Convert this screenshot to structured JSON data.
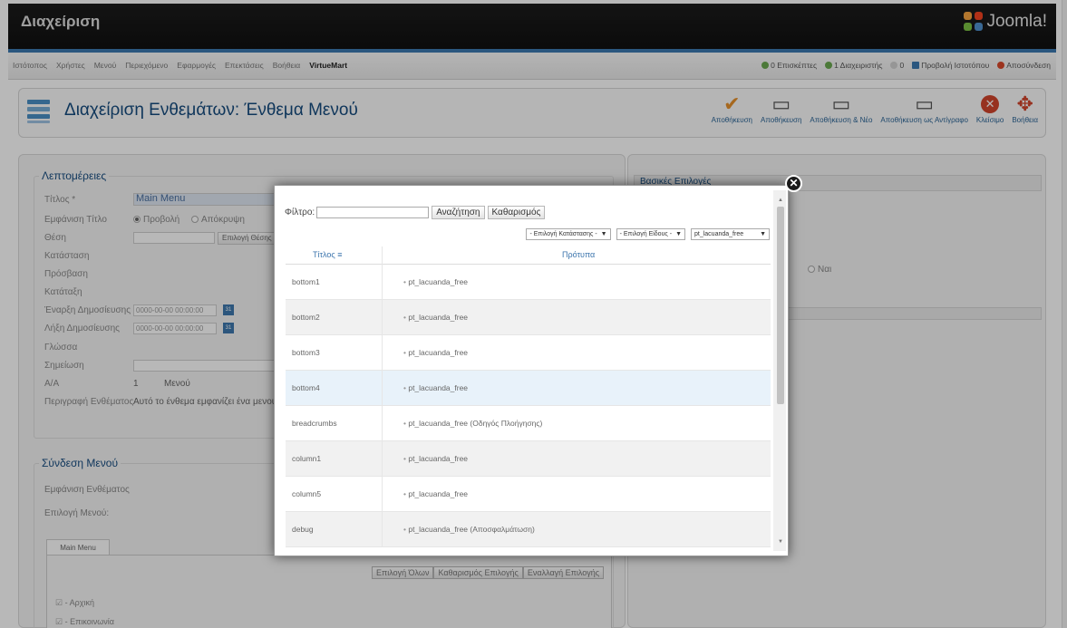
{
  "header": {
    "brand": "Διαχείριση",
    "logo_text": "Joomla!"
  },
  "menu": {
    "items": [
      "Ιστότοπος",
      "Χρήστες",
      "Μενού",
      "Περιεχόμενο",
      "Εφαρμογές",
      "Επεκτάσεις",
      "Βοήθεια",
      "VirtueMart"
    ],
    "status": {
      "visitors": "0 Επισκέπτες",
      "admins": "1 Διαχειριστής",
      "messages": "0",
      "view_site": "Προβολή Ιστοτόπου",
      "logout": "Αποσύνδεση"
    }
  },
  "toolbar": {
    "title": "Διαχείριση Ενθεμάτων: Ένθεμα Μενού",
    "buttons": [
      "Αποθήκευση",
      "Αποθήκευση",
      "Αποθήκευση & Νέο",
      "Αποθήκευση ως Αντίγραφο",
      "Κλείσιμο",
      "Βοήθεια"
    ]
  },
  "details": {
    "legend": "Λεπτομέρειες",
    "labels": {
      "title": "Τίτλος *",
      "show_title": "Εμφάνιση Τίτλο",
      "position": "Θέση",
      "status": "Κατάσταση",
      "access": "Πρόσβαση",
      "ordering": "Κατάταξη",
      "publish_up": "Έναρξη Δημοσίευσης",
      "publish_down": "Λήξη Δημοσίευσης",
      "language": "Γλώσσα",
      "note": "Σημείωση",
      "id": "Α/Α",
      "description": "Περιγραφή Ενθέματος"
    },
    "title_value": "Main Menu",
    "show_option": "Προβολή",
    "hide_option": "Απόκρυψη",
    "select_position": "Επιλογή Θέσης",
    "publish_up_value": "0000-00-00 00:00:00",
    "publish_down_value": "0000-00-00 00:00:00",
    "id_value": "1",
    "id_type": "Μενού",
    "description_value": "Αυτό το ένθεμα εμφανίζει ένα μενού στο"
  },
  "menu_assignment": {
    "legend": "Σύνδεση Μενού",
    "show_label": "Εμφάνιση Ενθέματος",
    "selection_label": "Επιλογή Μενού:",
    "tab": "Main Menu",
    "buttons": [
      "Επιλογή Όλων",
      "Καθαρισμός Επιλογής",
      "Εναλλαγή Επιλογής"
    ],
    "items": [
      "- Αρχική",
      "- Επικοινωνία"
    ]
  },
  "right": {
    "legend": "Βασικές Επιλογές",
    "yes": "Ναι"
  },
  "modal": {
    "filter_label": "Φίλτρο:",
    "filter_value": "",
    "search_button": "Αναζήτηση",
    "clear_button": "Καθαρισμός",
    "selects": [
      "- Επιλογή Κατάστασης -",
      "- Επιλογή Είδους -",
      "pt_lacuanda_free"
    ],
    "col_title": "Τίτλος",
    "col_templates": "Πρότυπα",
    "rows": [
      {
        "name": "bottom1",
        "template": "pt_lacuanda_free"
      },
      {
        "name": "bottom2",
        "template": "pt_lacuanda_free"
      },
      {
        "name": "bottom3",
        "template": "pt_lacuanda_free"
      },
      {
        "name": "bottom4",
        "template": "pt_lacuanda_free"
      },
      {
        "name": "breadcrumbs",
        "template": "pt_lacuanda_free (Οδηγός Πλοήγησης)"
      },
      {
        "name": "column1",
        "template": "pt_lacuanda_free"
      },
      {
        "name": "column5",
        "template": "pt_lacuanda_free"
      },
      {
        "name": "debug",
        "template": "pt_lacuanda_free (Αποσφαλμάτωση)"
      }
    ]
  },
  "colors": {
    "header": "#141414",
    "accent_blue": "#3c79b0",
    "title_blue": "#154b7e",
    "row_alt": "#f1f1f1",
    "row_highlight": "#e8f2fa"
  }
}
